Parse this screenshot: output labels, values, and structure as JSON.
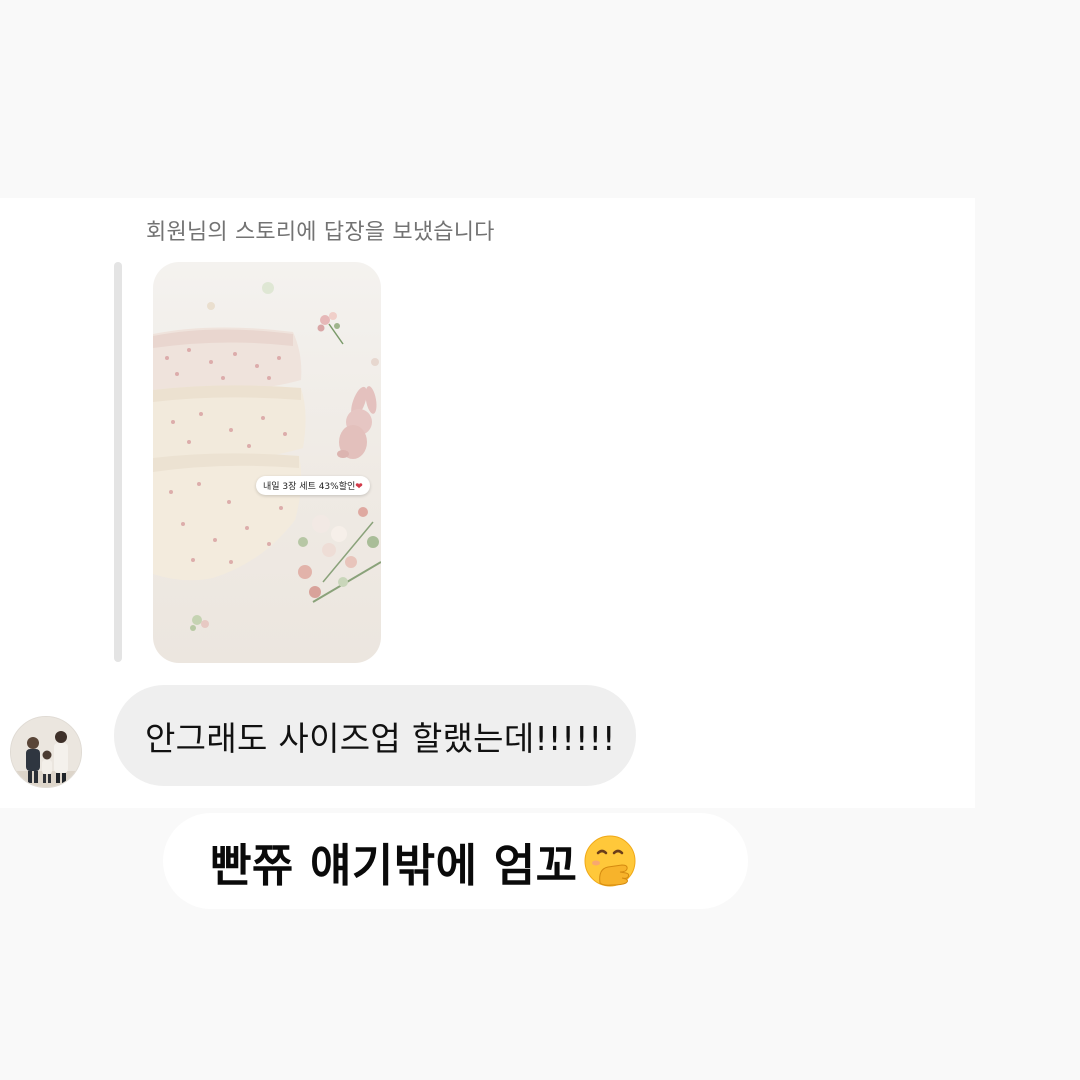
{
  "thread": {
    "reply_caption": "회원님의 스토리에 답장을 보냈습니다"
  },
  "story": {
    "sticker_text": "내일 3장 세트 43%할인",
    "sticker_heart": "❤"
  },
  "message": {
    "text": "안그래도 사이즈업 할랬는데!!!!!!"
  },
  "overlay_caption": {
    "text": "빤쮸 얘기밖에 엄꼬",
    "emoji": "face-with-hand-over-mouth"
  },
  "colors": {
    "page_background": "#f9f9f9",
    "panel_background": "#ffffff",
    "bubble_background": "#efefef",
    "caption_gray": "#737373"
  }
}
